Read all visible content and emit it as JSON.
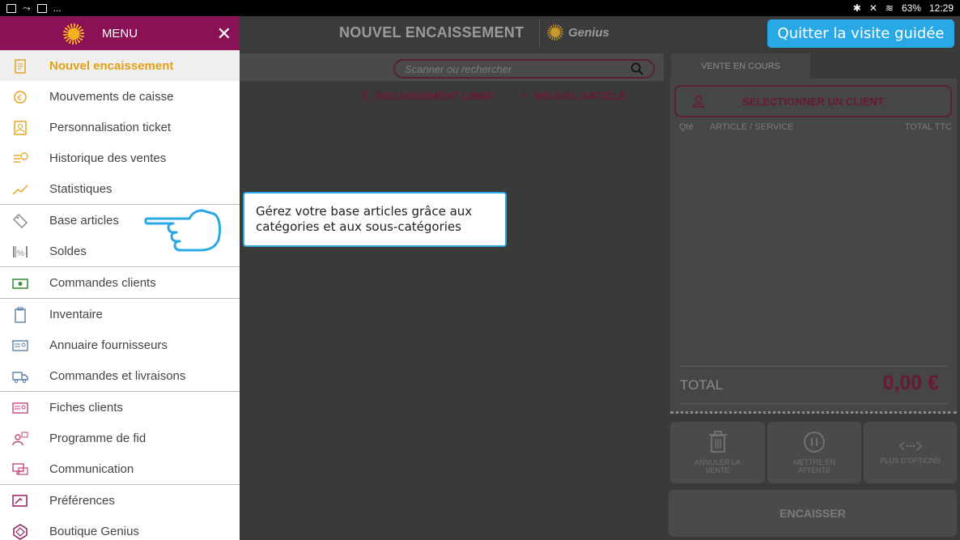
{
  "statusbar": {
    "left_text": "...",
    "battery": "63%",
    "time": "12:29"
  },
  "header": {
    "title": "NOUVEL ENCAISSEMENT",
    "brand": "Genius",
    "quit_label": "Quitter la visite guidée"
  },
  "search": {
    "placeholder": "Scanner ou rechercher"
  },
  "actions": {
    "free_label": "ENCAISSEMENT LIBRE",
    "new_article_label": "NOUVEL ARTICLE"
  },
  "sale": {
    "tab_label": "VENTE EN COURS",
    "client_button": "SÉLECTIONNER UN CLIENT",
    "col_qty": "Qté",
    "col_article": "ARTICLE / SERVICE",
    "col_total": "TOTAL TTC",
    "total_label": "TOTAL",
    "total_value": "0,00 €"
  },
  "buttons": {
    "cancel_line1": "ANNULER LA",
    "cancel_line2": "VENTE",
    "hold_line1": "METTRE EN",
    "hold_line2": "ATTENTE",
    "more": "PLUS D'OPTIONS",
    "checkout": "ENCAISSER"
  },
  "menu": {
    "title": "MENU",
    "items": [
      {
        "label": "Nouvel encaissement"
      },
      {
        "label": "Mouvements de caisse"
      },
      {
        "label": "Personnalisation ticket"
      },
      {
        "label": "Historique des ventes"
      },
      {
        "label": "Statistiques"
      },
      {
        "label": "Base articles"
      },
      {
        "label": "Soldes"
      },
      {
        "label": "Commandes clients"
      },
      {
        "label": "Inventaire"
      },
      {
        "label": "Annuaire fournisseurs"
      },
      {
        "label": "Commandes et livraisons"
      },
      {
        "label": "Fiches clients"
      },
      {
        "label": "Programme de fid"
      },
      {
        "label": "Communication"
      },
      {
        "label": "Préférences"
      },
      {
        "label": "Boutique Genius"
      }
    ]
  },
  "tooltip": {
    "line1": "Gérez votre base articles grâce aux",
    "line2": "catégories et aux sous-catégories"
  },
  "colors": {
    "menu_header": "#8b1156",
    "active_item": "#e2a017",
    "accent_blue": "#29a8e6",
    "dark_accent": "#6a1a30"
  }
}
